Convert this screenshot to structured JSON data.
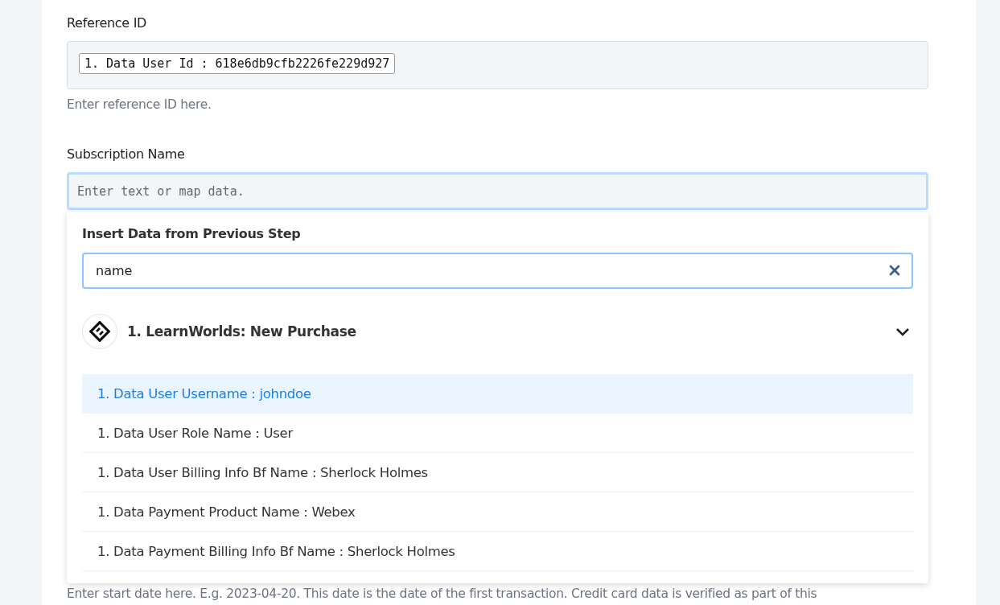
{
  "fields": [
    {
      "label": "Reference ID",
      "chip": "1. Data User Id : 618e6db9cfb2226fe229d927",
      "help": "Enter reference ID here."
    },
    {
      "label": "Subscription Name",
      "placeholder": "Enter text or map data.",
      "focused": true
    }
  ],
  "dropdown": {
    "title": "Insert Data from Previous Step",
    "search": {
      "value": "name"
    },
    "step": {
      "title": "1. LearnWorlds: New Purchase",
      "expanded": true
    },
    "items": [
      {
        "label": "1. Data User Username : johndoe",
        "selected": true
      },
      {
        "label": "1. Data User Role Name : User",
        "selected": false
      },
      {
        "label": "1. Data User Billing Info Bf Name : Sherlock Holmes",
        "selected": false
      },
      {
        "label": "1. Data Payment Product Name : Webex",
        "selected": false
      },
      {
        "label": "1. Data Payment Billing Info Bf Name : Sherlock Holmes",
        "selected": false
      }
    ]
  },
  "start_date_help": "Enter start date here. E.g. 2023-04-20. This date is the date of the first transaction. Credit card data is verified as part of this"
}
